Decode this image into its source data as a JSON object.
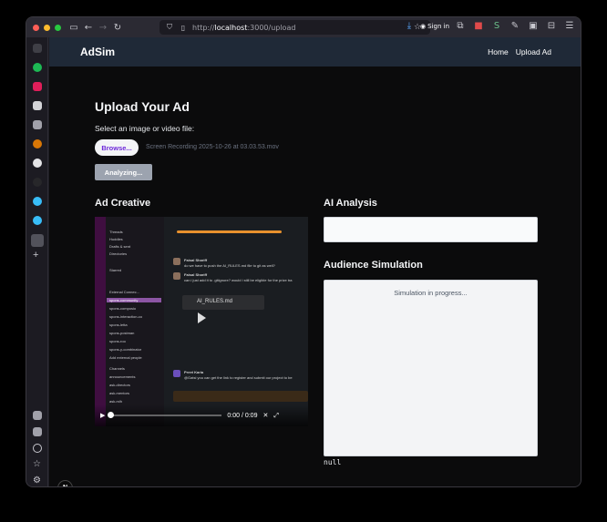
{
  "browser": {
    "url_prefix": "http://",
    "url_host": "localhost",
    "url_path": ":3000/upload",
    "sign_in": "Sign in"
  },
  "nav": {
    "brand": "AdSim",
    "links": [
      "Home",
      "Upload Ad"
    ]
  },
  "upload": {
    "title": "Upload Your Ad",
    "select_label": "Select an image or video file:",
    "browse_label": "Browse...",
    "file_name": "Screen Recording 2025-10-26 at 03.03.53.mov",
    "analyzing_label": "Analyzing..."
  },
  "creative": {
    "heading": "Ad Creative",
    "video": {
      "time": "0:00 / 0:09",
      "file_card": "AI_RULES.md",
      "sidebar_items": [
        "Threads",
        "Huddles",
        "Drafts & sent",
        "Directories",
        "Starred",
        "External Connec...",
        "spons-community",
        "spons-composio",
        "spons-interaction-co",
        "spons-letta",
        "spons-postman",
        "spons-roo",
        "spons-y-combinator",
        "Add external people",
        "Channels",
        "announcements",
        "ask-directors",
        "ask-mentors",
        "ask-mlh"
      ],
      "messages": [
        {
          "author": "Faisal Shariff",
          "text": "do we have to push the AI_RULES.md file to git as well?"
        },
        {
          "author": "Faisal Shariff",
          "text": "can i just add it to .gitignore? would i still be eligible for the prize tra"
        },
        {
          "author": "Preet Karia",
          "text": "@Gatsi you can get the link to register and submit our project to be"
        }
      ]
    }
  },
  "analysis": {
    "heading": "AI Analysis",
    "value": ""
  },
  "simulation": {
    "heading": "Audience Simulation",
    "status": "Simulation in progress...",
    "result": "null"
  },
  "dev_badge": "N",
  "colors": {
    "nav_bg": "#1f2937",
    "page_bg": "#0b0b0c",
    "accent": "#6d28d9",
    "button_disabled": "#9ca3af"
  }
}
